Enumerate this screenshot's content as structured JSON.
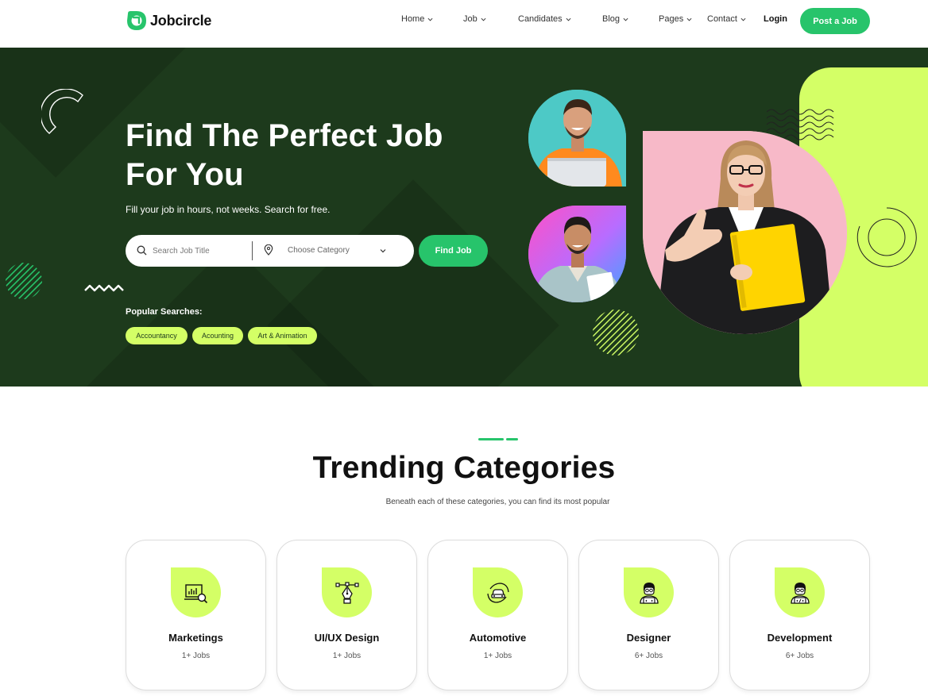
{
  "brand": {
    "name": "Jobcircle",
    "color": "#27c46b"
  },
  "nav": {
    "items": [
      {
        "label": "Home",
        "has_dropdown": true
      },
      {
        "label": "Job",
        "has_dropdown": true
      },
      {
        "label": "Candidates",
        "has_dropdown": true
      },
      {
        "label": "Blog",
        "has_dropdown": true
      },
      {
        "label": "Pages",
        "has_dropdown": true
      },
      {
        "label": "Contact",
        "has_dropdown": true
      }
    ],
    "login_label": "Login",
    "post_job_label": "Post a Job"
  },
  "hero": {
    "title_line1": "Find The Perfect Job",
    "title_line2": "For You",
    "subtitle": "Fill your job in hours, not weeks. Search for free.",
    "search": {
      "placeholder": "Search Job Title",
      "category_label": "Choose Category",
      "button_label": "Find Job"
    },
    "popular_label": "Popular Searches:",
    "popular_tags": [
      "Accountancy",
      "Acounting",
      "Art & Animation"
    ],
    "colors": {
      "background": "#1d3a1c",
      "accent": "#d4ff66",
      "pink": "#f7b9c8"
    }
  },
  "trending": {
    "title": "Trending Categories",
    "subtitle": "Beneath each of these categories, you can find its most popular",
    "categories": [
      {
        "name": "Marketings",
        "count": "1+ Jobs",
        "icon": "marketing-chart-icon"
      },
      {
        "name": "UI/UX Design",
        "count": "1+ Jobs",
        "icon": "pen-tool-icon"
      },
      {
        "name": "Automotive",
        "count": "1+ Jobs",
        "icon": "car-icon"
      },
      {
        "name": "Designer",
        "count": "6+ Jobs",
        "icon": "designer-person-icon"
      },
      {
        "name": "Development",
        "count": "6+ Jobs",
        "icon": "developer-person-icon"
      }
    ]
  }
}
